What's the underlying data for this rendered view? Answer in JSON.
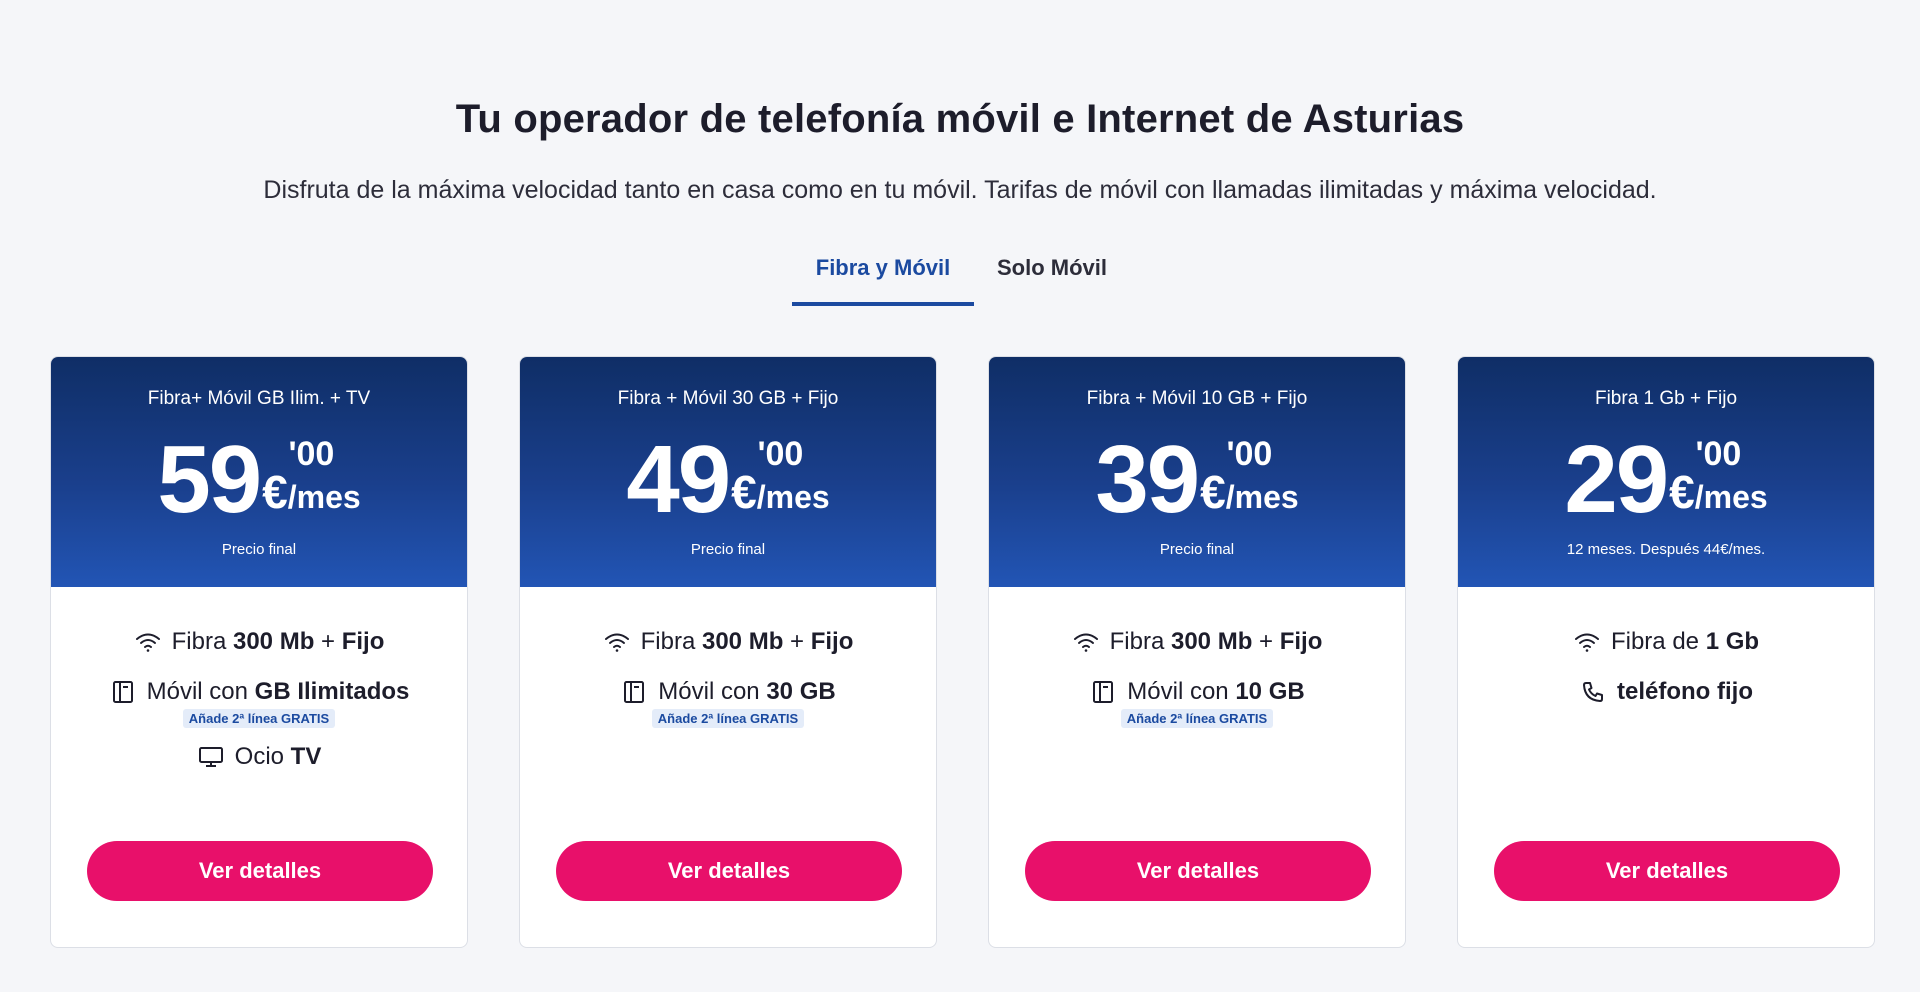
{
  "header": {
    "title": "Tu operador de telefonía móvil e Internet de Asturias",
    "subtitle": "Disfruta de la máxima velocidad tanto en casa como en tu móvil. Tarifas de móvil con llamadas ilimitadas y máxima velocidad."
  },
  "tabs": [
    {
      "label": "Fibra y Móvil",
      "active": true
    },
    {
      "label": "Solo Móvil",
      "active": false
    }
  ],
  "colors": {
    "accent": "#1b4aa0",
    "button": "#e8106a",
    "header_gradient_top": "#0f2e66",
    "header_gradient_bottom": "#2255b5"
  },
  "plans": [
    {
      "name": "Fibra+ Móvil GB Ilim. + TV",
      "price_int": "59",
      "price_dec": "'00",
      "price_unit": "/mes",
      "currency": "€",
      "note": "Precio final",
      "features": [
        {
          "icon": "wifi-icon",
          "pre": "Fibra ",
          "bold": "300 Mb",
          "mid": " + ",
          "bold2": "Fijo"
        },
        {
          "icon": "mobile-icon",
          "pre": "Móvil con ",
          "bold": "GB Ilimitados",
          "mid": "",
          "bold2": "",
          "badge": "Añade 2ª línea GRATIS"
        },
        {
          "icon": "tv-icon",
          "pre": "Ocio ",
          "bold": "TV",
          "mid": "",
          "bold2": ""
        }
      ],
      "button": "Ver detalles"
    },
    {
      "name": "Fibra + Móvil 30 GB + Fijo",
      "price_int": "49",
      "price_dec": "'00",
      "price_unit": "/mes",
      "currency": "€",
      "note": "Precio final",
      "features": [
        {
          "icon": "wifi-icon",
          "pre": "Fibra ",
          "bold": "300 Mb",
          "mid": " + ",
          "bold2": "Fijo"
        },
        {
          "icon": "mobile-icon",
          "pre": "Móvil con ",
          "bold": "30 GB",
          "mid": "",
          "bold2": "",
          "badge": "Añade 2ª línea GRATIS"
        }
      ],
      "button": "Ver detalles"
    },
    {
      "name": "Fibra + Móvil 10 GB + Fijo",
      "price_int": "39",
      "price_dec": "'00",
      "price_unit": "/mes",
      "currency": "€",
      "note": "Precio final",
      "features": [
        {
          "icon": "wifi-icon",
          "pre": "Fibra ",
          "bold": "300 Mb",
          "mid": " + ",
          "bold2": "Fijo"
        },
        {
          "icon": "mobile-icon",
          "pre": "Móvil con ",
          "bold": "10 GB",
          "mid": "",
          "bold2": "",
          "badge": "Añade 2ª línea GRATIS"
        }
      ],
      "button": "Ver detalles"
    },
    {
      "name": "Fibra 1 Gb + Fijo",
      "price_int": "29",
      "price_dec": "'00",
      "price_unit": "/mes",
      "currency": "€",
      "note": "12 meses. Después 44€/mes.",
      "features": [
        {
          "icon": "wifi-icon",
          "pre": "Fibra de ",
          "bold": "1 Gb",
          "mid": "",
          "bold2": ""
        },
        {
          "icon": "phone-icon",
          "pre": "",
          "bold": "teléfono fijo",
          "mid": "",
          "bold2": ""
        }
      ],
      "button": "Ver detalles"
    }
  ]
}
